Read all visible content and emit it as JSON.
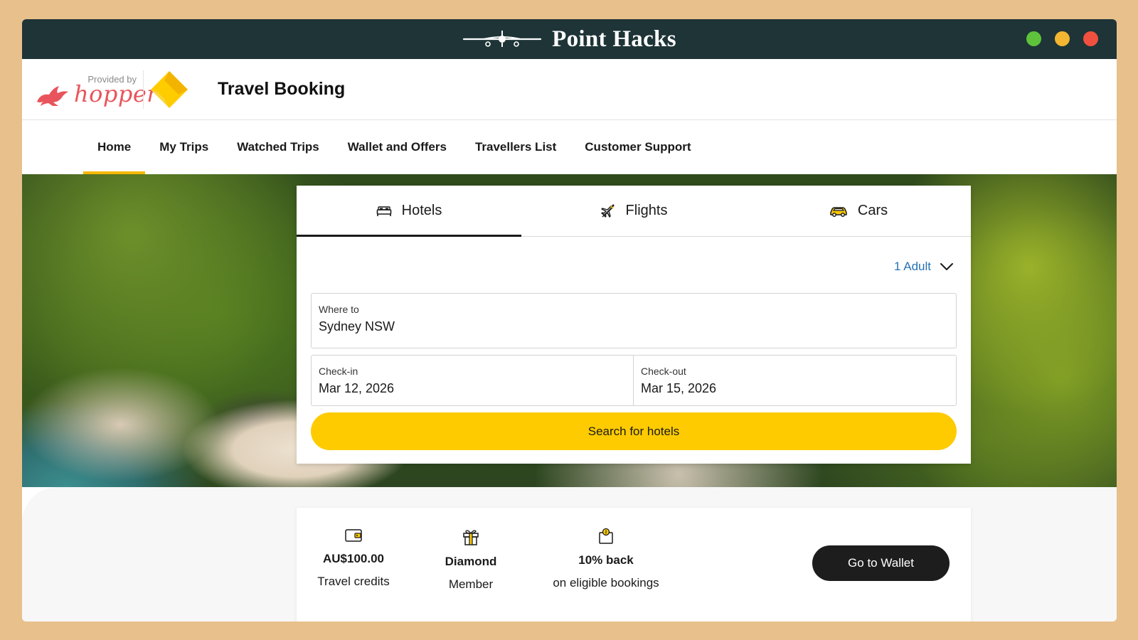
{
  "window": {
    "brand_title": "Point Hacks",
    "controls": [
      {
        "name": "green-dot",
        "color": "#5ec23a"
      },
      {
        "name": "yellow-dot",
        "color": "#f2b632"
      },
      {
        "name": "red-dot",
        "color": "#f0503f"
      }
    ]
  },
  "header": {
    "provided_by": "Provided by",
    "hopper_word": "hopper",
    "app_title": "Travel Booking"
  },
  "nav": {
    "items": [
      {
        "label": "Home",
        "active": true
      },
      {
        "label": "My Trips"
      },
      {
        "label": "Watched Trips"
      },
      {
        "label": "Wallet and Offers"
      },
      {
        "label": "Travellers List"
      },
      {
        "label": "Customer Support"
      }
    ]
  },
  "search": {
    "tabs": [
      {
        "label": "Hotels",
        "icon": "bed-icon",
        "active": true
      },
      {
        "label": "Flights",
        "icon": "plane-icon"
      },
      {
        "label": "Cars",
        "icon": "car-icon"
      }
    ],
    "travellers": "1 Adult",
    "where_to": {
      "label": "Where to",
      "value": "Sydney NSW"
    },
    "check_in": {
      "label": "Check-in",
      "value": "Mar 12, 2026"
    },
    "check_out": {
      "label": "Check-out",
      "value": "Mar 15, 2026"
    },
    "button": "Search for hotels"
  },
  "rewards": {
    "items": [
      {
        "icon": "wallet-icon",
        "value": "AU$100.00",
        "sub": "Travel credits"
      },
      {
        "icon": "gift-icon",
        "value": "Diamond",
        "sub": "Member"
      },
      {
        "icon": "cashback-icon",
        "value": "10% back",
        "sub": "on eligible bookings"
      }
    ],
    "button": "Go to Wallet"
  },
  "colors": {
    "accent_yellow": "#fecb00",
    "titlebar": "#1e3437",
    "link_blue": "#2673b5",
    "hopper_red": "#e9545c"
  }
}
